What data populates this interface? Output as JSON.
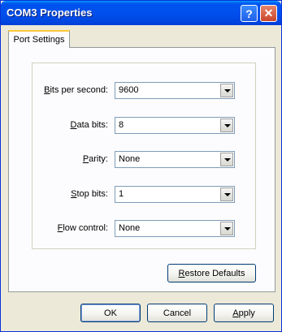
{
  "window": {
    "title": "COM3 Properties"
  },
  "titlebar_buttons": {
    "help": "?",
    "close": "✕"
  },
  "tabs": [
    {
      "label": "Port Settings"
    }
  ],
  "fields": [
    {
      "label_pre": "",
      "label_key": "B",
      "label_post": "its per second:",
      "value": "9600"
    },
    {
      "label_pre": "",
      "label_key": "D",
      "label_post": "ata bits:",
      "value": "8"
    },
    {
      "label_pre": "",
      "label_key": "P",
      "label_post": "arity:",
      "value": "None"
    },
    {
      "label_pre": "",
      "label_key": "S",
      "label_post": "top bits:",
      "value": "1"
    },
    {
      "label_pre": "",
      "label_key": "F",
      "label_post": "low control:",
      "value": "None"
    }
  ],
  "restore_defaults": {
    "key": "R",
    "rest": "estore Defaults"
  },
  "footer": {
    "ok": "OK",
    "cancel": "Cancel",
    "apply_key": "A",
    "apply_rest": "pply"
  }
}
